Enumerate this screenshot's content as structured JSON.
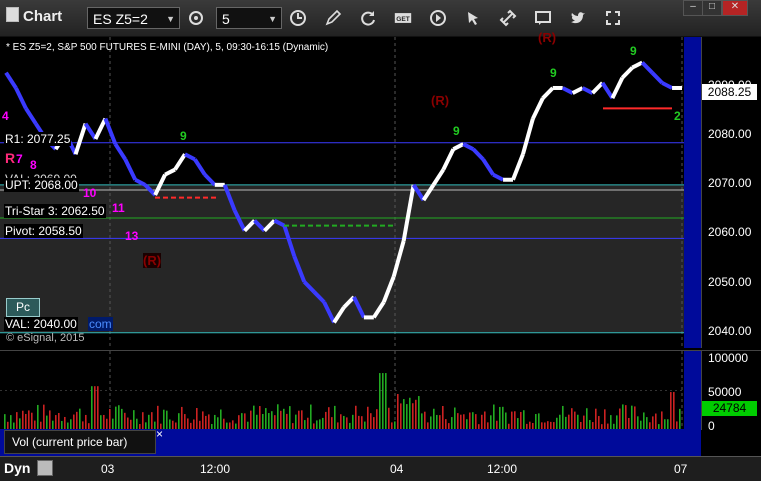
{
  "window": {
    "title": "Chart"
  },
  "toolbar": {
    "symbol_value": "ES Z5=2",
    "interval_value": "5",
    "buttons": [
      "target-icon",
      "clock-icon",
      "pencil-icon",
      "refresh-icon",
      "get-icon",
      "play-icon",
      "cursor-icon",
      "comment-icon",
      "twitter-icon",
      "expand-icon"
    ],
    "get_label": "GET"
  },
  "chart": {
    "header": "* ES Z5=2, S&P 500 FUTURES E-MINI (DAY), 5, 09:30-16:15 (Dynamic)",
    "y_labels": [
      "2090.00",
      "2080.00",
      "2070.00",
      "2060.00",
      "2050.00",
      "2040.00"
    ],
    "last_price": "2088.25",
    "levels": [
      {
        "name": "R1",
        "label": "R1: 2077.25",
        "value": 2077.25,
        "color": "#3a3aff"
      },
      {
        "name": "VAL-upper",
        "label": "VAL: 2069.00",
        "value": 2069.0,
        "color": "#33bbbb"
      },
      {
        "name": "UPT",
        "label": "UPT: 2068.00",
        "value": 2068.0,
        "color": "#bbbbbb"
      },
      {
        "name": "Tri-Star",
        "label": "Tri-Star 3: 2062.50",
        "value": 2062.5,
        "color": "#22aa22"
      },
      {
        "name": "Pivot",
        "label": "Pivot: 2058.50",
        "value": 2058.5,
        "color": "#3a3aff"
      },
      {
        "name": "VAL",
        "label": "VAL: 2040.00",
        "value": 2040.0,
        "color": "#33bbbb"
      }
    ],
    "r_marks": [
      "(R)",
      "(R)",
      "(R)"
    ],
    "count_labels": [
      "4",
      "7",
      "8",
      "10",
      "11",
      "13",
      "9",
      "9",
      "9",
      "9",
      "2"
    ],
    "pc_label": "Pc",
    "overlay_text": "com",
    "copyright": "© eSignal, 2015",
    "r1_suffix": "R"
  },
  "chart_data": {
    "type": "line",
    "title": "ES Z5=2, S&P 500 FUTURES E-MINI (DAY), 5, 09:30-16:15 (Dynamic)",
    "ylim": [
      2037,
      2098
    ],
    "x": [
      0,
      10,
      20,
      30,
      40,
      50,
      60,
      70,
      80,
      90,
      100,
      110,
      120,
      130,
      140,
      150,
      160,
      170,
      180,
      190,
      200,
      210,
      220,
      230,
      240,
      250,
      260,
      270,
      280,
      290,
      300,
      310,
      320,
      330,
      340,
      350,
      360,
      370,
      380,
      390,
      400,
      410,
      420,
      430,
      440,
      450,
      460,
      470,
      480,
      490,
      500,
      510,
      520,
      530,
      540,
      550,
      560,
      570,
      580,
      590,
      600,
      610,
      620,
      630,
      640,
      650,
      660,
      670,
      680
    ],
    "series": [
      {
        "values": [
          2091,
          2088,
          2084,
          2081,
          2078,
          2076,
          2079,
          2075,
          2081,
          2078,
          2082,
          2077,
          2074,
          2070,
          2069,
          2067,
          2071,
          2072,
          2075,
          2074,
          2071,
          2069,
          2069,
          2064,
          2060,
          2062,
          2060,
          2062,
          2061,
          2055,
          2050,
          2048,
          2046,
          2042,
          2045,
          2047,
          2043,
          2043,
          2046,
          2051,
          2058,
          2069,
          2066,
          2069,
          2072,
          2076,
          2077,
          2076,
          2074,
          2071,
          2070,
          2070,
          2075,
          2082,
          2086,
          2088,
          2088,
          2087,
          2088,
          2087,
          2089,
          2086,
          2090,
          2092,
          2093,
          2091,
          2089,
          2088,
          2088
        ]
      }
    ],
    "volume": {
      "ylim": [
        0,
        100000
      ],
      "last": 24784,
      "labels": [
        "100000",
        "50000",
        "0"
      ]
    }
  },
  "volume_pane": {
    "label": "Vol (current price bar)",
    "close_glyph": "×",
    "last_value": "24784",
    "y_labels": [
      "100000",
      "50000",
      "0"
    ]
  },
  "time_axis": {
    "mode": "Dyn",
    "labels": [
      "03",
      "12:00",
      "04",
      "12:00",
      "07"
    ]
  }
}
